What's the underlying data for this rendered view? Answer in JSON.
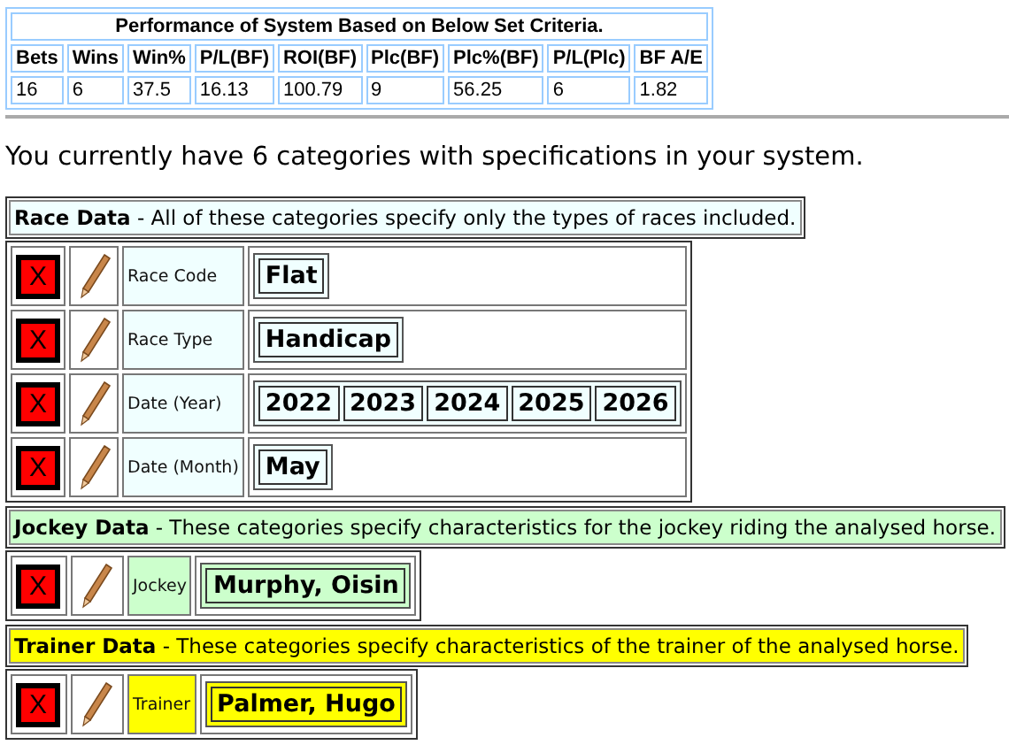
{
  "performance": {
    "title": "Performance of System Based on Below Set Criteria.",
    "columns": [
      "Bets",
      "Wins",
      "Win%",
      "P/L(BF)",
      "ROI(BF)",
      "Plc(BF)",
      "Plc%(BF)",
      "P/L(Plc)",
      "BF A/E"
    ],
    "values": [
      "16",
      "6",
      "37.5",
      "16.13",
      "100.79",
      "9",
      "56.25",
      "6",
      "1.82"
    ]
  },
  "summary": "You currently have 6 categories with specifications in your system.",
  "sections": [
    {
      "title": "**Race Data** - All of these categories specify only the types of races included.",
      "color": "#f0ffff",
      "full_width": true,
      "rows": [
        {
          "delete": "X",
          "label": "Race Code",
          "values": [
            "Flat"
          ]
        },
        {
          "delete": "X",
          "label": "Race Type",
          "values": [
            "Handicap"
          ]
        },
        {
          "delete": "X",
          "label": "Date (Year)",
          "values": [
            "2022",
            "2023",
            "2024",
            "2025",
            "2026"
          ]
        },
        {
          "delete": "X",
          "label": "Date (Month)",
          "values": [
            "May"
          ]
        }
      ]
    },
    {
      "title": "**Jockey Data** - These categories specify characteristics for the jockey riding the analysed horse.",
      "color": "#ccffcc",
      "full_width": false,
      "rows": [
        {
          "delete": "X",
          "label": "Jockey",
          "values": [
            "Murphy, Oisin"
          ]
        }
      ]
    },
    {
      "title": "**Trainer Data** - These categories specify characteristics of the trainer of the analysed horse.",
      "color": "#ffff00",
      "full_width": false,
      "rows": [
        {
          "delete": "X",
          "label": "Trainer",
          "values": [
            "Palmer, Hugo"
          ]
        }
      ]
    }
  ]
}
